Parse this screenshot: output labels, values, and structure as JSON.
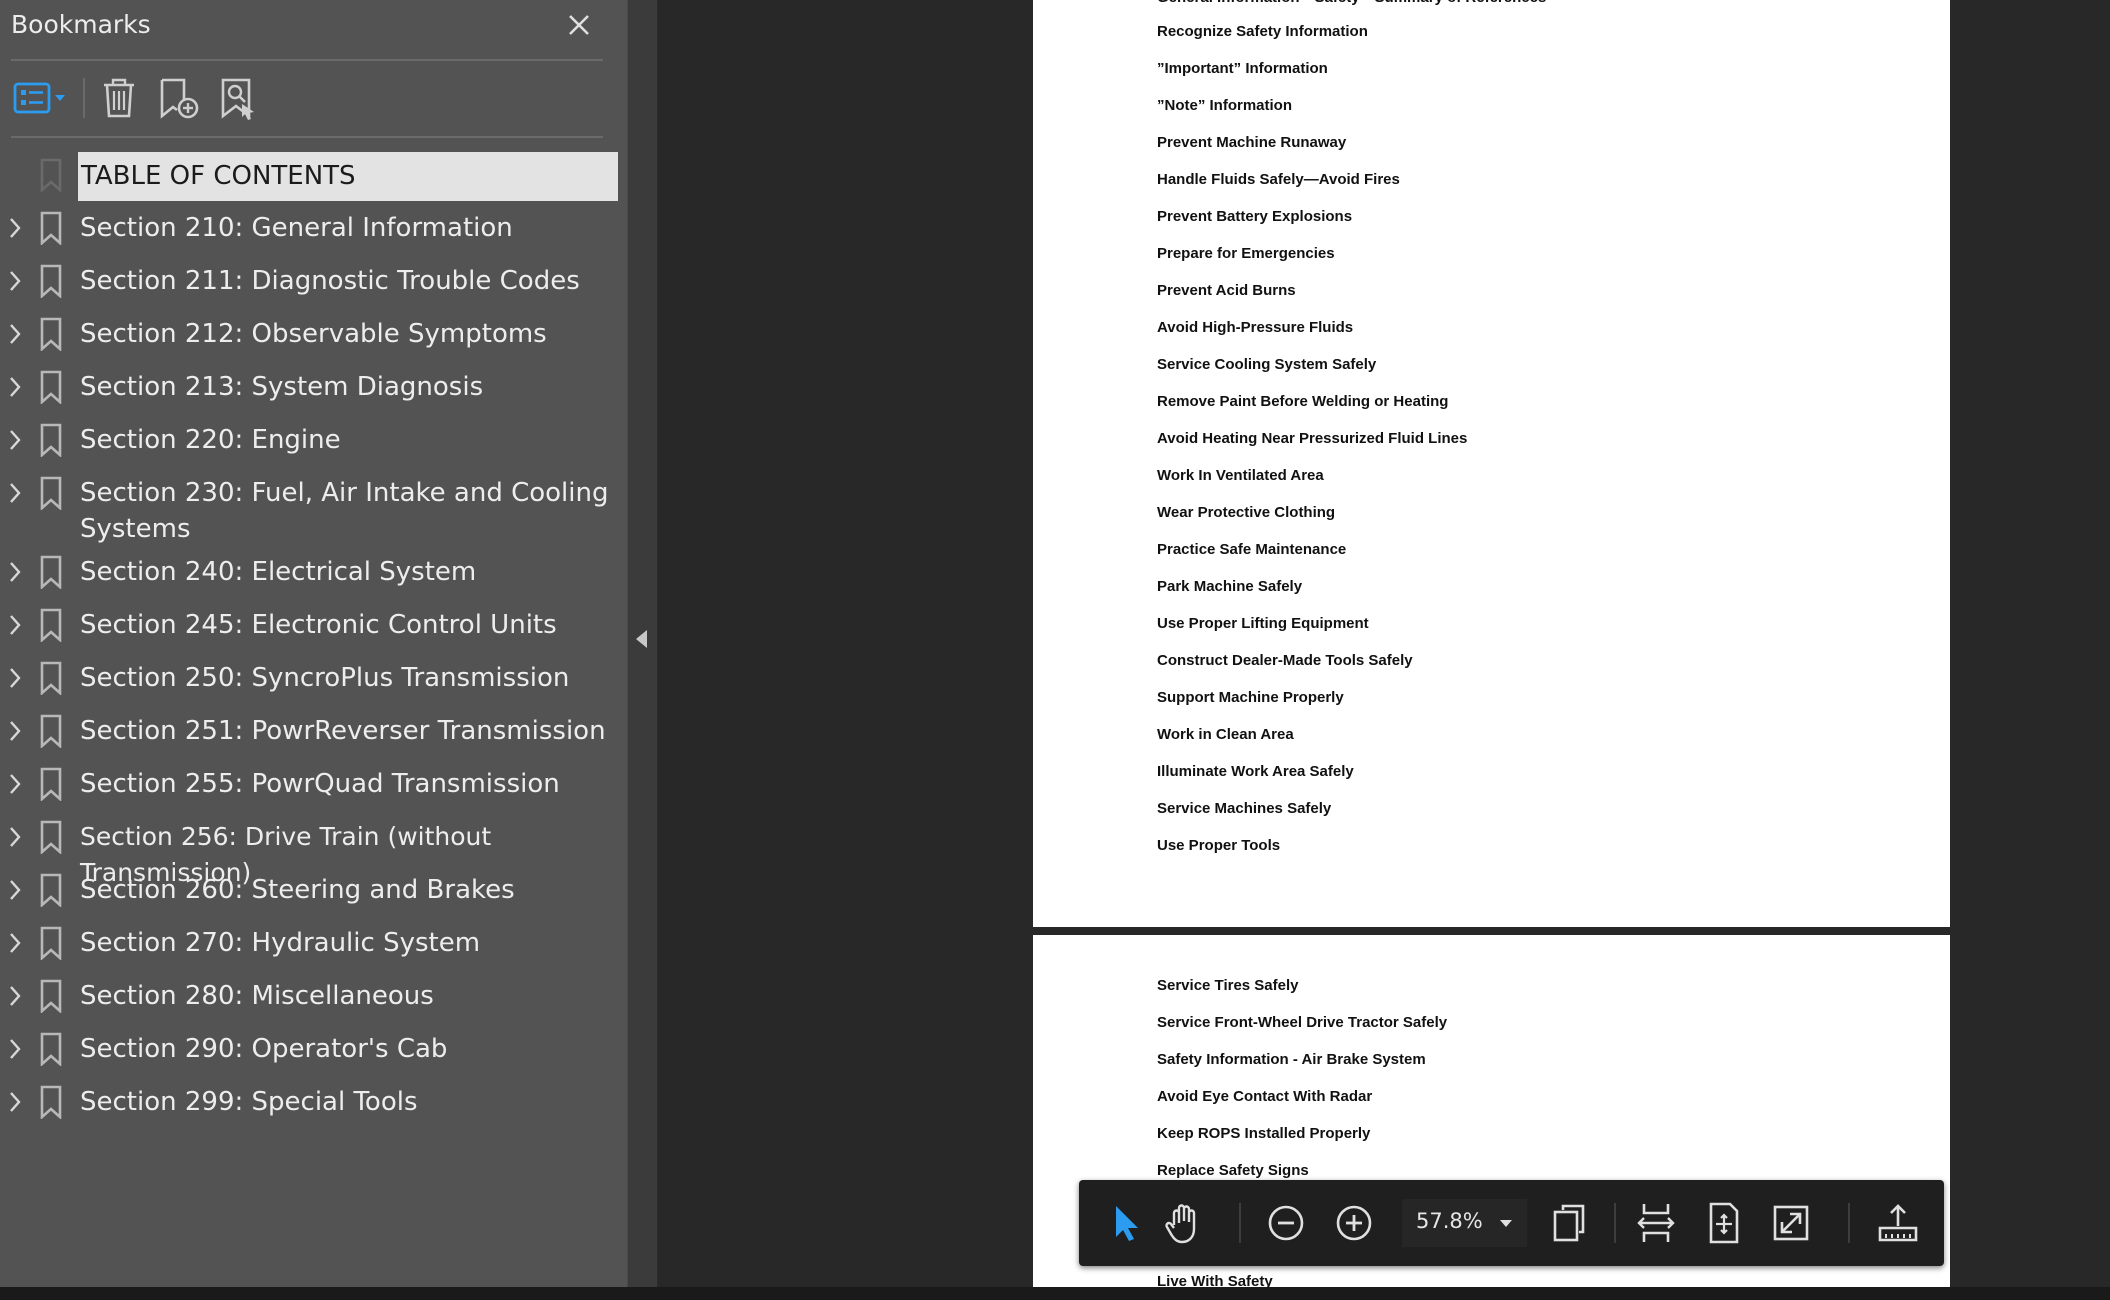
{
  "bookmarks_panel": {
    "title": "Bookmarks",
    "toolbar": {
      "options_icon": "list-options-icon",
      "delete_icon": "trash-icon",
      "add_icon": "add-bookmark-icon",
      "new_from_selection_icon": "bookmark-search-icon"
    },
    "items": [
      {
        "label": "TABLE OF CONTENTS",
        "expandable": false,
        "selected": true
      },
      {
        "label": "Section 210: General Information",
        "expandable": true
      },
      {
        "label": "Section 211: Diagnostic Trouble Codes",
        "expandable": true
      },
      {
        "label": "Section 212: Observable Symptoms",
        "expandable": true
      },
      {
        "label": "Section 213: System Diagnosis",
        "expandable": true
      },
      {
        "label": "Section 220: Engine",
        "expandable": true
      },
      {
        "label": "Section 230: Fuel, Air Intake and Cooling Systems",
        "expandable": true
      },
      {
        "label": "Section 240: Electrical System",
        "expandable": true
      },
      {
        "label": "Section 245: Electronic Control Units",
        "expandable": true
      },
      {
        "label": "Section 250: SyncroPlus Transmission",
        "expandable": true
      },
      {
        "label": "Section 251: PowrReverser Transmission",
        "expandable": true
      },
      {
        "label": "Section 255: PowrQuad Transmission",
        "expandable": true
      },
      {
        "label": "Section 256: Drive Train (without Transmission)",
        "expandable": true
      },
      {
        "label": "Section 260: Steering and Brakes",
        "expandable": true
      },
      {
        "label": "Section 270: Hydraulic System",
        "expandable": true
      },
      {
        "label": "Section 280: Miscellaneous",
        "expandable": true
      },
      {
        "label": "Section 290: Operator's Cab",
        "expandable": true
      },
      {
        "label": "Section 299: Special Tools",
        "expandable": true
      }
    ]
  },
  "document": {
    "page1_lines": [
      "Recognize Safety Information",
      "”Important” Information",
      "”Note” Information",
      "Prevent Machine Runaway",
      "Handle Fluids Safely—Avoid Fires",
      "Prevent Battery Explosions",
      "Prepare for Emergencies",
      "Prevent Acid Burns",
      "Avoid High-Pressure Fluids",
      "Service Cooling System Safely",
      "Remove Paint Before Welding or Heating",
      "Avoid Heating Near Pressurized Fluid Lines",
      "Work In Ventilated Area",
      "Wear Protective Clothing",
      "Practice Safe Maintenance",
      "Park Machine Safely",
      "Use Proper Lifting Equipment",
      "Construct Dealer-Made Tools Safely",
      "Support Machine Properly",
      "Work in Clean Area",
      "Illuminate Work Area Safely",
      "Service Machines Safely",
      "Use Proper Tools"
    ],
    "page2_lines": [
      "Service Tires Safely",
      "Service Front-Wheel Drive Tractor Safely",
      "Safety Information - Air Brake System",
      "Avoid Eye Contact With Radar",
      "Keep ROPS Installed Properly",
      "Replace Safety Signs"
    ],
    "page2_bottom_line": "Live With Safety"
  },
  "floating_toolbar": {
    "zoom": "57.8%",
    "icons": [
      "select-arrow-icon",
      "hand-tool-icon",
      "zoom-out-icon",
      "zoom-in-icon",
      "zoom-dropdown-icon",
      "page-thumbnails-icon",
      "fit-width-icon",
      "fit-page-icon",
      "full-screen-icon",
      "share-upload-icon"
    ],
    "accent_color": "#2c9cf0"
  }
}
